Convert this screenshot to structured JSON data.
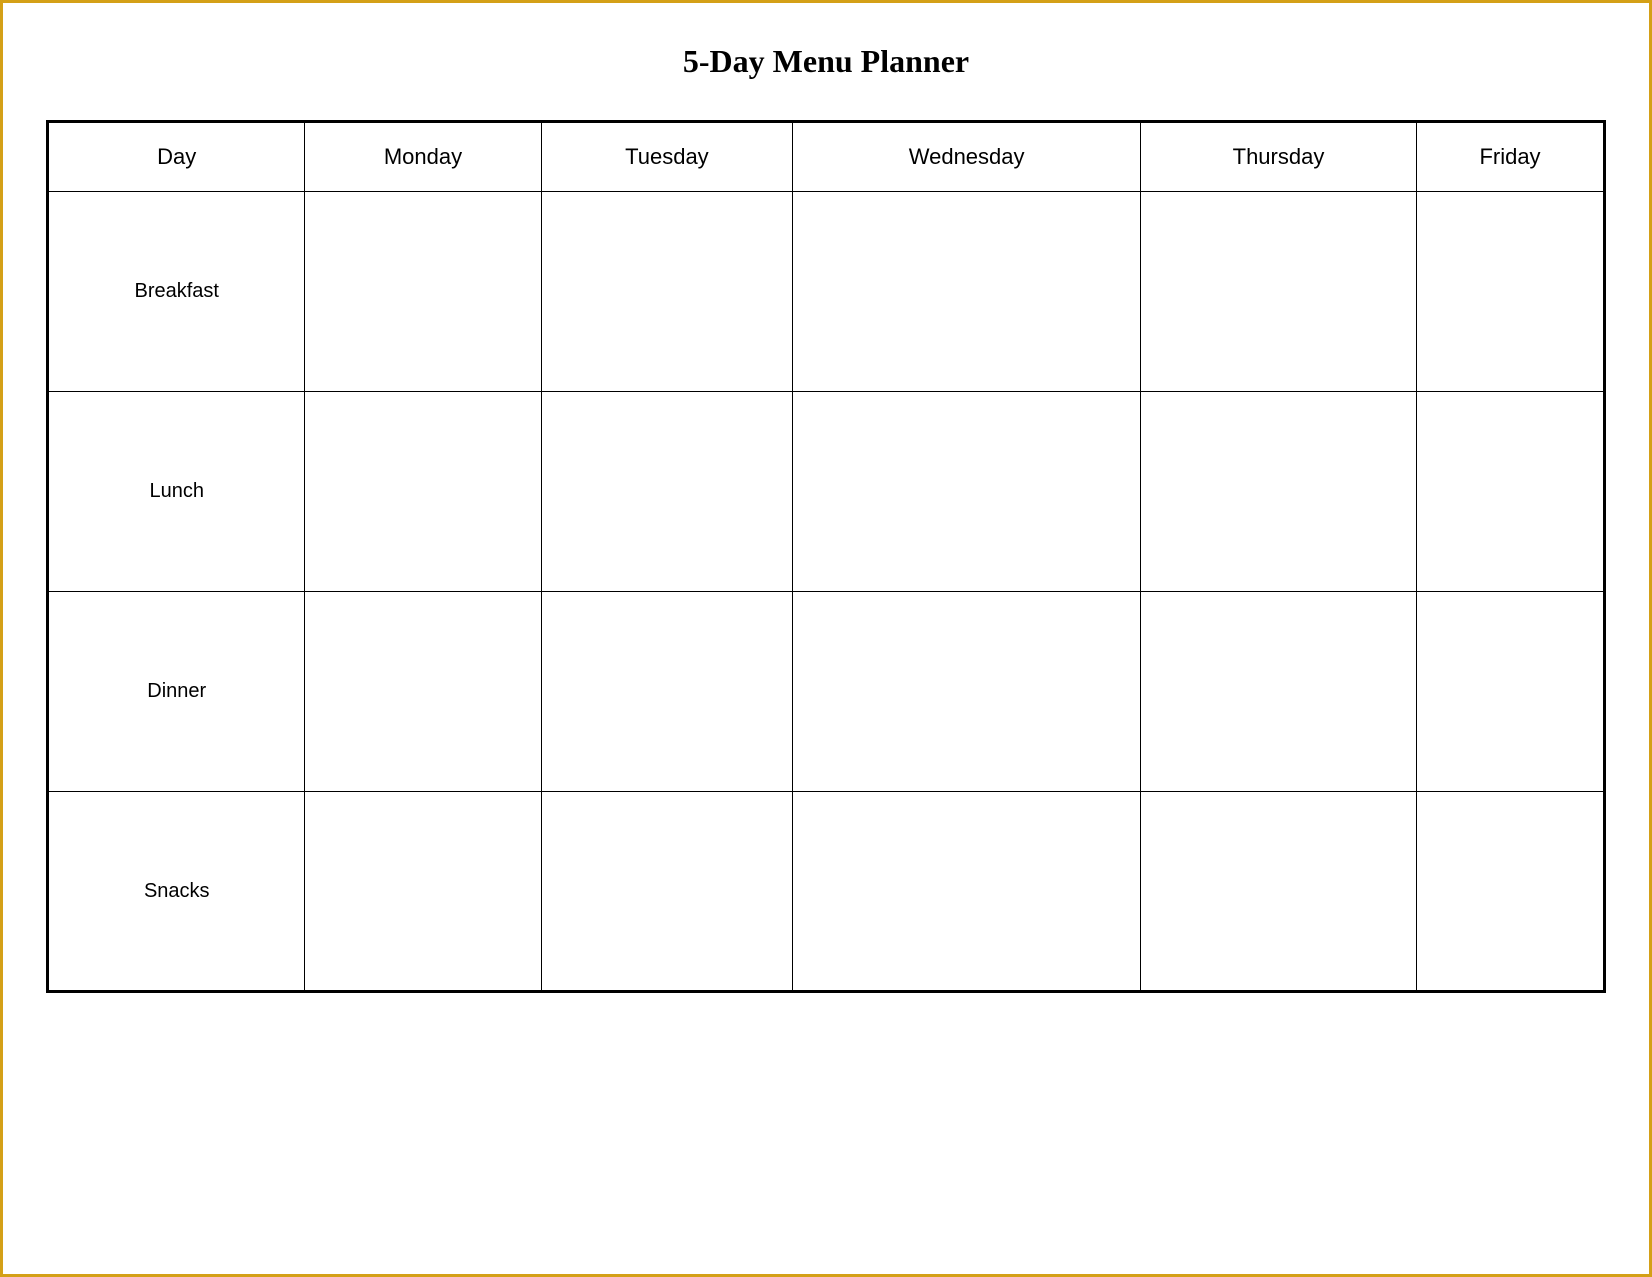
{
  "page": {
    "title": "5-Day Menu Planner",
    "border_color": "#d4a017"
  },
  "table": {
    "headers": {
      "day_col": "Day",
      "monday": "Monday",
      "tuesday": "Tuesday",
      "wednesday": "Wednesday",
      "thursday": "Thursday",
      "friday": "Friday"
    },
    "rows": [
      {
        "label": "Breakfast"
      },
      {
        "label": "Lunch"
      },
      {
        "label": "Dinner"
      },
      {
        "label": "Snacks"
      }
    ]
  }
}
